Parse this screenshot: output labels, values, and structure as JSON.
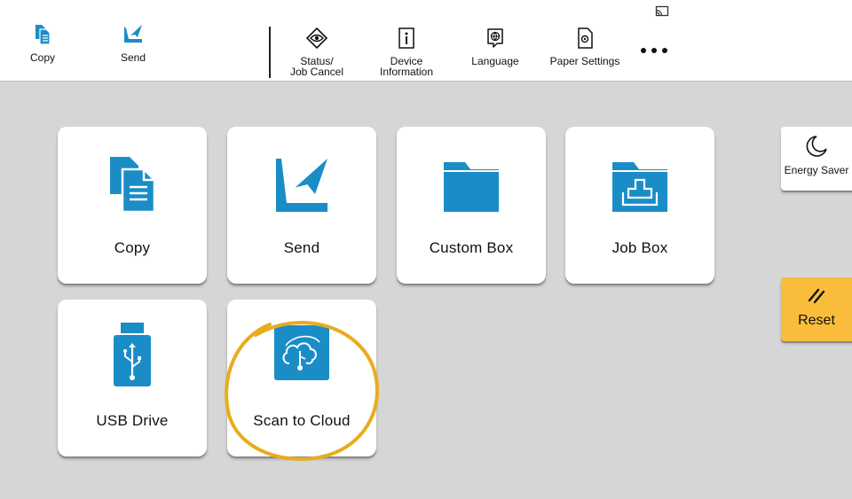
{
  "colors": {
    "accent": "#1a8dc7",
    "reset": "#f9bd3b",
    "ring": "#e8ac1d",
    "background": "#d6d6d6"
  },
  "topbar": {
    "copy_label": "Copy",
    "send_label": "Send",
    "status_line1": "Status/",
    "status_line2": "Job Cancel",
    "device_line1": "Device",
    "device_line2": "Information",
    "language_label": "Language",
    "paper_label": "Paper Settings"
  },
  "tiles": {
    "copy": "Copy",
    "send": "Send",
    "custom_box": "Custom Box",
    "job_box": "Job Box",
    "usb_drive": "USB Drive",
    "scan_to_cloud": "Scan to Cloud"
  },
  "side": {
    "energy_saver": "Energy Saver",
    "reset": "Reset"
  }
}
